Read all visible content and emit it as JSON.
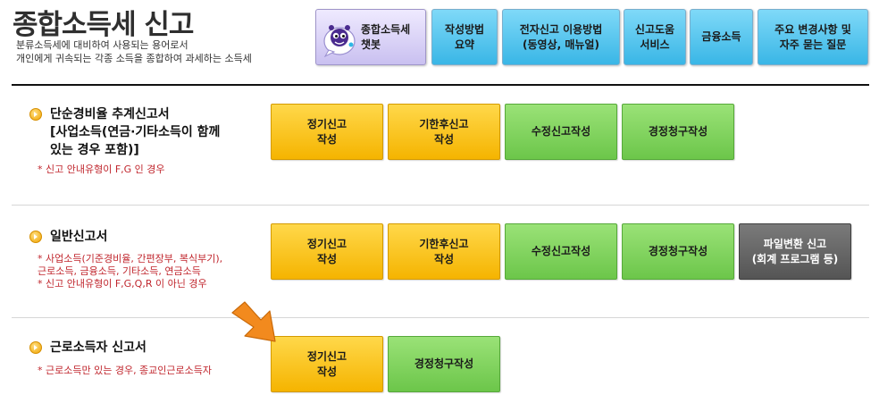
{
  "header": {
    "title": "종합소득세 신고",
    "subtitle": "분류소득세에 대비하여 사용되는 용어로서\n개인에게 귀속되는 각종 소득을 종합하여 과세하는 소득세"
  },
  "top_nav": [
    {
      "label": "종합소득세\n챗봇",
      "icon": "chatbot-mascot-icon"
    },
    {
      "label": "작성방법\n요약"
    },
    {
      "label": "전자신고 이용방법\n(동영상, 매뉴얼)"
    },
    {
      "label": "신고도움\n서비스"
    },
    {
      "label": "금융소득"
    },
    {
      "label": "주요 변경사항 및\n자주 묻는 질문"
    }
  ],
  "sections": [
    {
      "title": "단순경비율 추계신고서\n[사업소득(연금·기타소득이 함께\n있는 경우 포함)]",
      "note": "* 신고 안내유형이 F,G 인 경우",
      "buttons": [
        {
          "label": "정기신고\n작성",
          "color": "#f5b400"
        },
        {
          "label": "기한후신고\n작성",
          "color": "#f5b400"
        },
        {
          "label": "수정신고작성",
          "color": "#6cc64a"
        },
        {
          "label": "경정청구작성",
          "color": "#6cc64a"
        }
      ]
    },
    {
      "title": "일반신고서",
      "note": "* 사업소득(기준경비율, 간편장부, 복식부기),\n  근로소득, 금융소득, 기타소득, 연금소득\n* 신고 안내유형이 F,G,Q,R 이 아닌 경우",
      "buttons": [
        {
          "label": "정기신고\n작성",
          "color": "#f5b400"
        },
        {
          "label": "기한후신고\n작성",
          "color": "#f5b400"
        },
        {
          "label": "수정신고작성",
          "color": "#6cc64a"
        },
        {
          "label": "경정청구작성",
          "color": "#6cc64a"
        },
        {
          "label": "파일변환 신고\n(회계 프로그램 등)",
          "color": "#555555"
        }
      ]
    },
    {
      "title": "근로소득자 신고서",
      "note": "* 근로소득만 있는 경우, 종교인근로소득자",
      "buttons": [
        {
          "label": "정기신고\n작성",
          "color": "#f5b400"
        },
        {
          "label": "경정청구작성",
          "color": "#6cc64a"
        }
      ]
    }
  ],
  "pointer": {
    "icon": "orange-arrow-icon",
    "color": "#f28a1e"
  }
}
